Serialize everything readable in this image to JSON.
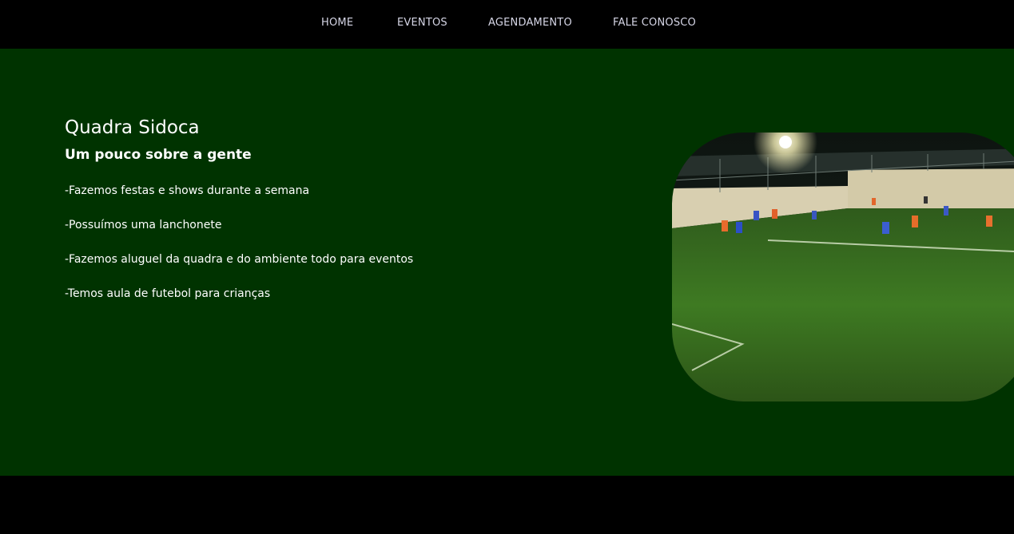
{
  "nav": {
    "items": [
      {
        "label": "HOME"
      },
      {
        "label": "EVENTOS"
      },
      {
        "label": "AGENDAMENTO"
      },
      {
        "label": "FALE CONOSCO"
      }
    ]
  },
  "main": {
    "title": "Quadra Sidoca",
    "subtitle": "Um pouco sobre a gente",
    "items": [
      "-Fazemos festas e shows durante a semana",
      "-Possuímos uma lanchonete",
      "-Fazemos aluguel da quadra e do ambiente todo para eventos",
      "-Temos aula de futebol para crianças"
    ]
  },
  "colors": {
    "background": "#000000",
    "main_background": "#003300",
    "nav_text": "#d6d6e6",
    "text": "#ffffff"
  }
}
